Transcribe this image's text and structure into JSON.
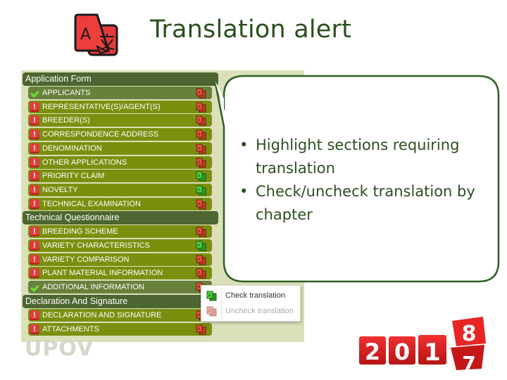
{
  "slide": {
    "title": "Translation alert",
    "title_icon": "translate-icon"
  },
  "sections": [
    {
      "header": "Application Form",
      "items": [
        {
          "label": "APPLICANTS",
          "status": "complete",
          "translation": "red"
        },
        {
          "label": "REPRESENTATIVE(S)/AGENT(S)",
          "status": "warning",
          "translation": "red"
        },
        {
          "label": "BREEDER(S)",
          "status": "warning",
          "translation": "red"
        },
        {
          "label": "CORRESPONDENCE ADDRESS",
          "status": "warning",
          "translation": "red"
        },
        {
          "label": "DENOMINATION",
          "status": "warning",
          "translation": "red"
        },
        {
          "label": "OTHER APPLICATIONS",
          "status": "warning",
          "translation": "red"
        },
        {
          "label": "PRIORITY CLAIM",
          "status": "warning",
          "translation": "green"
        },
        {
          "label": "NOVELTY",
          "status": "warning",
          "translation": "green"
        },
        {
          "label": "TECHNICAL EXAMINATION",
          "status": "warning",
          "translation": "red"
        }
      ]
    },
    {
      "header": "Technical Questionnaire",
      "items": [
        {
          "label": "BREEDING SCHEME",
          "status": "warning",
          "translation": "red"
        },
        {
          "label": "VARIETY CHARACTERISTICS",
          "status": "warning",
          "translation": "green"
        },
        {
          "label": "VARIETY COMPARISON",
          "status": "warning",
          "translation": "red"
        },
        {
          "label": "PLANT MATERIAL INFORMATION",
          "status": "warning",
          "translation": "red"
        },
        {
          "label": "ADDITIONAL INFORMATION",
          "status": "complete",
          "translation": "red"
        }
      ]
    },
    {
      "header": "Declaration And Signature",
      "items": [
        {
          "label": "DECLARATION AND SIGNATURE",
          "status": "warning",
          "translation": "red"
        },
        {
          "label": "ATTACHMENTS",
          "status": "warning",
          "translation": "red"
        }
      ]
    }
  ],
  "context_menu": {
    "items": [
      {
        "label": "Check translation",
        "enabled": true
      },
      {
        "label": "Uncheck translation",
        "enabled": false
      }
    ]
  },
  "callout": {
    "bullets": [
      "Highlight sections requiring translation",
      "Check/uncheck translation by chapter"
    ]
  },
  "logo": "UPOV",
  "year_graphic": {
    "digits": [
      "2",
      "0",
      "1"
    ],
    "flip_top": "8",
    "flip_bottom": "7"
  },
  "colors": {
    "header": "#4d6530",
    "row": "#7b8f0f",
    "row_done": "#67813c",
    "panel": "#dbe0b8",
    "warning": "#e03b3b",
    "accent": "#2b4f1f",
    "translate_red": "#e04a2c",
    "translate_green": "#3fbf3a"
  }
}
